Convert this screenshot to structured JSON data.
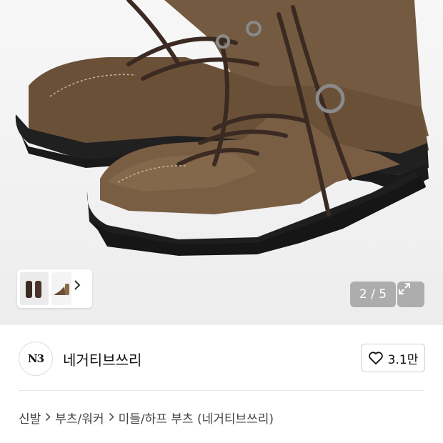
{
  "gallery": {
    "counter_current": "2",
    "counter_separator": "/",
    "counter_total": "5",
    "counter_text": "2 / 5",
    "thumbnail_next_icon": "chevron-right-icon",
    "expand_icon": "expand-arrows-icon"
  },
  "brand": {
    "logo_text": "N3",
    "name": "네거티브쓰리",
    "like_icon": "heart-outline-icon",
    "like_count": "3.1만"
  },
  "breadcrumb": {
    "items": [
      "신발",
      "부츠/워커",
      "미들/하프 부츠 (네거티브쓰리)"
    ],
    "separator_icon": "chevron-right-icon"
  },
  "colors": {
    "leather": "#6b5038",
    "sole": "#1e1e1e",
    "lace": "#3a2a22",
    "hero_bg": "#efefef"
  }
}
